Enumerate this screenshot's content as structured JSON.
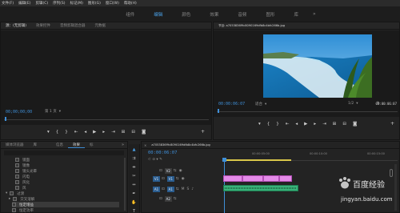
{
  "menu": [
    "文件(F)",
    "编辑(E)",
    "剪辑(C)",
    "序列(S)",
    "标记(M)",
    "图形(G)",
    "窗口(W)",
    "帮助(H)"
  ],
  "workspaces": {
    "items": [
      "组件",
      "编辑",
      "颜色",
      "效果",
      "音频",
      "图形",
      "库"
    ],
    "active_index": 1,
    "more": "»"
  },
  "source_panel": {
    "tabs": [
      "源：(无剪辑)",
      "效果控件",
      "音频剪辑混合器",
      "元数据"
    ],
    "timecode": "00;00;00;00",
    "page_label": "第 1 页"
  },
  "program_panel": {
    "title": "节目: a7053836f9c8090169dfb8c4bfc266b.jpg",
    "timecode": "00:00:06:07",
    "fit_label": "适合",
    "zoom_label": "1/2",
    "end_timecode": "00:00:06:07"
  },
  "project_panel": {
    "tabs": [
      "媒体浏览器",
      "库",
      "信息",
      "效果",
      "标"
    ],
    "items": [
      "镜面",
      "镜像",
      "镜头光晕",
      "闪电",
      "风化",
      "风",
      "过渡",
      "交叉溶解",
      "恒定增益",
      "恒定功率"
    ]
  },
  "timeline": {
    "title": "a7053836f9c8090169dfb8c4bfc266b.jpg",
    "timecode": "00:00:06:07",
    "ruler_labels": [
      "00:00:05:00",
      "00:00:10:00",
      "00:00:15:00"
    ],
    "tracks": {
      "v2": "V2",
      "v1": "V1",
      "a1": "A1",
      "a2": "A2",
      "v1_target": "V1",
      "a1_target": "A1",
      "m": "M",
      "s": "S"
    }
  },
  "watermark": {
    "line1": "百度经验",
    "line2": "jingyan.baidu.com"
  }
}
